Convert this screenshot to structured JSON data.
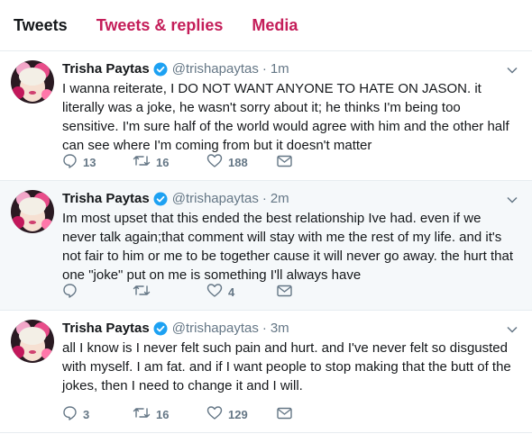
{
  "tabs": [
    {
      "label": "Tweets"
    },
    {
      "label": "Tweets & replies"
    },
    {
      "label": "Media"
    }
  ],
  "colors": {
    "accent": "#c41d59",
    "muted": "#657786",
    "highlight_bg": "#f5f8fa",
    "verified": "#1da1f2"
  },
  "tweets": [
    {
      "name": "Trisha Paytas",
      "handle": "@trishapaytas",
      "sep": "·",
      "time": "1m",
      "text": "I wanna reiterate, I DO NOT WANT ANYONE TO HATE ON JASON. it literally was a joke, he wasn't sorry about it; he thinks I'm being too sensitive. I'm sure half of the world would agree with him and the other half can see where I'm coming from but it doesn't matter",
      "replies": "13",
      "retweets": "16",
      "likes": "188"
    },
    {
      "name": "Trisha Paytas",
      "handle": "@trishapaytas",
      "sep": "·",
      "time": "2m",
      "text": "Im most upset that this ended the best relationship Ive had. even if we never talk again;that comment will stay with me the rest of my life. and it's not fair to him or me to be together cause it will never go away. the hurt that one \"joke\" put on me is something I'll always have",
      "replies": "",
      "retweets": "",
      "likes": "4"
    },
    {
      "name": "Trisha Paytas",
      "handle": "@trishapaytas",
      "sep": "·",
      "time": "3m",
      "text": "all I know is I never felt such pain and hurt. and I've never felt so disgusted with myself. I am fat. and if I want people to stop making that the butt of the jokes, then I need to change it and I will.",
      "replies": "3",
      "retweets": "16",
      "likes": "129"
    }
  ]
}
